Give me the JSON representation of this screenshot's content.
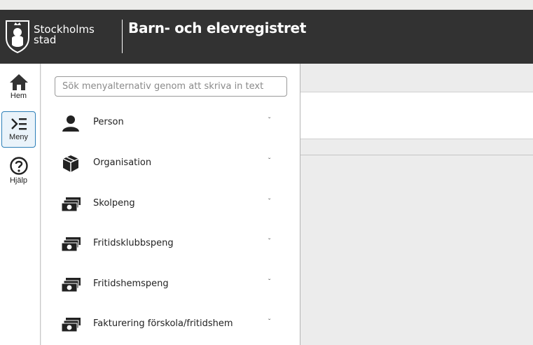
{
  "header": {
    "logo_line1": "Stockholms",
    "logo_line2": "stad",
    "app_title": "Barn- och elevregistret"
  },
  "rail": [
    {
      "label": "Hem",
      "icon": "home-icon"
    },
    {
      "label": "Meny",
      "icon": "menu-icon",
      "active": true
    },
    {
      "label": "Hjälp",
      "icon": "help-icon"
    }
  ],
  "menu": {
    "search_placeholder": "Sök menyalternativ genom att skriva in text",
    "items": [
      {
        "label": "Person",
        "icon": "person-icon"
      },
      {
        "label": "Organisation",
        "icon": "box-icon"
      },
      {
        "label": "Skolpeng",
        "icon": "money-icon"
      },
      {
        "label": "Fritidsklubbspeng",
        "icon": "money-icon"
      },
      {
        "label": "Fritidshemspeng",
        "icon": "money-icon"
      },
      {
        "label": "Fakturering förskola/fritidshem",
        "icon": "money-icon"
      }
    ],
    "chevron": "ˇ"
  },
  "colors": {
    "header_bg": "#323232",
    "accent": "#2c7fb8"
  }
}
